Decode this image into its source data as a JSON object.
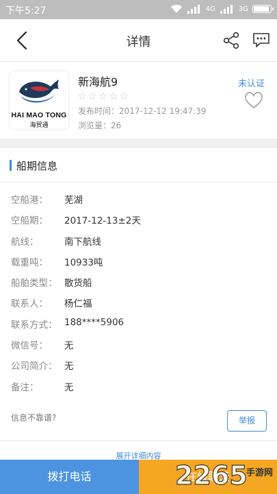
{
  "status_bar": {
    "time": "下午5:27",
    "network": "4G",
    "signal_text": "3G"
  },
  "nav": {
    "title": "详情"
  },
  "profile": {
    "name": "新海航9",
    "rating": "☆☆☆☆☆",
    "publish_time": "发布时间：2017-12-12 19:47:39",
    "views": "浏览量：26",
    "certification": "未认证",
    "logo_text": "HAI MAO TONG",
    "logo_sub": "海贸通"
  },
  "section": {
    "title": "船期信息"
  },
  "details": [
    {
      "key": "空船港：",
      "value": "芜湖"
    },
    {
      "key": "空船期：",
      "value": "2017-12-13±2天"
    },
    {
      "key": "航线：",
      "value": "南下航线"
    },
    {
      "key": "载重吨：",
      "value": "10933吨"
    },
    {
      "key": "船舶类型：",
      "value": "散货船"
    },
    {
      "key": "联系人：",
      "value": "杨仁福"
    },
    {
      "key": "联系方式：",
      "value": "188****5906"
    },
    {
      "key": "微信号：",
      "value": "无"
    },
    {
      "key": "公司简介：",
      "value": "无"
    },
    {
      "key": "备注：",
      "value": "无"
    }
  ],
  "report": {
    "question": "信息不靠谱?",
    "button": "举报"
  },
  "expand_label": "展开详细内容",
  "actions": {
    "call": "拨打电话",
    "chat": "在线聊天"
  },
  "watermark": {
    "brand": "2265",
    "site": "手游网"
  },
  "colors": {
    "accent": "#3d8bd9",
    "call": "#4c93e0",
    "chat": "#f5a623"
  }
}
